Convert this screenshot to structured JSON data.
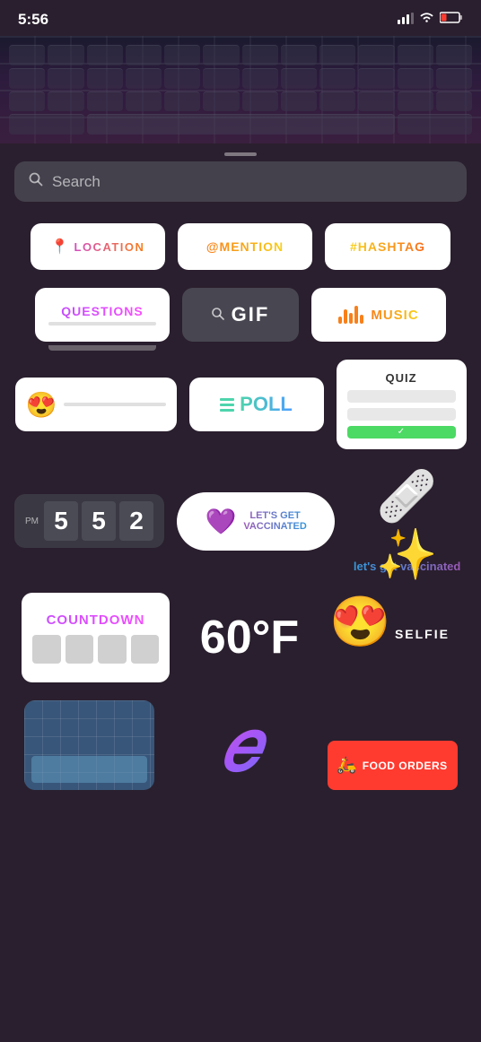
{
  "statusBar": {
    "time": "5:56",
    "signal": "▲▲▲",
    "wifi": "wifi",
    "battery": "🔴"
  },
  "search": {
    "placeholder": "Search"
  },
  "stickers": {
    "row1": {
      "location": "📍 LOCATION",
      "locationLabel": "LOCATION",
      "mention": "@MENTION",
      "hashtag": "#HASHTAG"
    },
    "row2": {
      "questions": "QUESTIONS",
      "gif": "GIF",
      "music": "MUSIC"
    },
    "row3": {
      "poll": "POLL",
      "quiz": "QUIZ"
    },
    "row4": {
      "clock": "5 5 2",
      "pm": "PM",
      "vaccinated1": "LET'S GET",
      "vaccinated2": "VACCINATED",
      "vaccineDeco": "let's get vaccinated"
    },
    "row5": {
      "countdown": "COUNTDOWN",
      "temp": "60°F",
      "selfie": "SELFIE"
    },
    "row6": {
      "foodOrders": "FOOD ORDERS"
    }
  },
  "colors": {
    "locationGradient": [
      "#d44dbf",
      "#f8801a"
    ],
    "mentionGradient": [
      "#f8801a",
      "#f8d01a"
    ],
    "hashtagGradient": [
      "#f8d01a",
      "#f86c1a"
    ],
    "questionsGradient": [
      "#c44dff",
      "#f84dff"
    ],
    "musicGradient": [
      "#f8801a",
      "#f8d01a"
    ],
    "pollGradient": [
      "#4dd4ac",
      "#4d9fff"
    ],
    "countdownGradient": [
      "#c44dff",
      "#f84dff"
    ],
    "vaccGradient": [
      "#9b59b6",
      "#3498db"
    ],
    "foodBg": "#ff3b30"
  }
}
